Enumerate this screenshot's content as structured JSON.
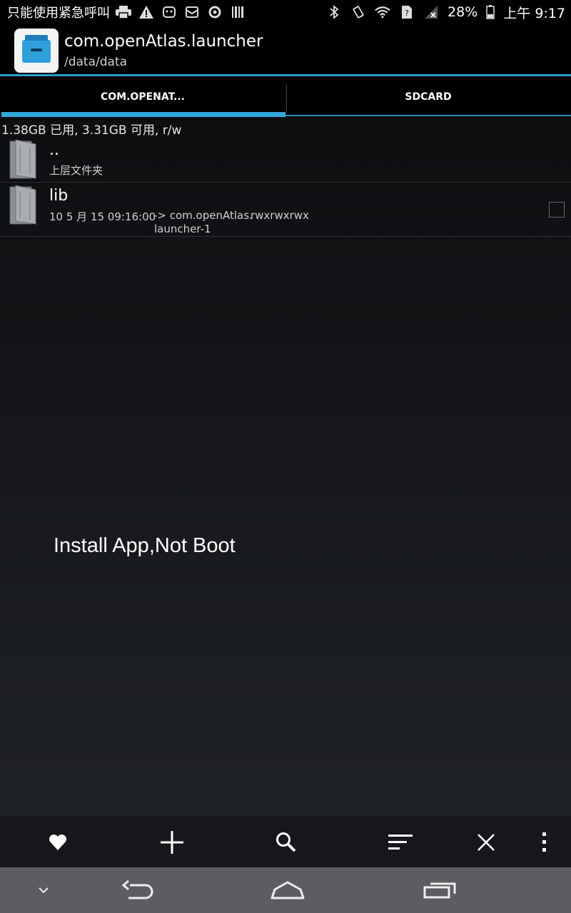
{
  "status_bar": {
    "carrier_text": "只能使用紧急呼叫",
    "battery_percent": "28%",
    "time": "上午 9:17",
    "icons_left": [
      "print-icon",
      "warning-icon",
      "android-icon",
      "mail-icon",
      "sync-icon",
      "barcode-icon"
    ],
    "icons_right": [
      "bluetooth-icon",
      "vibrate-icon",
      "wifi-icon",
      "no-sim-icon",
      "no-signal-icon",
      "battery-icon"
    ]
  },
  "action_bar": {
    "title": "com.openAtlas.launcher",
    "subtitle": "/data/data"
  },
  "tabs": [
    {
      "label": "COM.OPENAT...",
      "active": true
    },
    {
      "label": "SDCARD",
      "active": false
    }
  ],
  "storage_info": "1.38GB 已用, 3.31GB 可用, r/w",
  "files": [
    {
      "name": "..",
      "line1": "上层文件夹"
    },
    {
      "name": "lib",
      "date": "10 5 月 15 09:16:00",
      "link": "-> com.openAtlas.",
      "link2": "launcher-1",
      "perms": "rwxrwxrwx",
      "checked": false
    }
  ],
  "overlay_text": "Install App,Not Boot",
  "toolbar": [
    "favorite-icon",
    "add-icon",
    "search-icon",
    "sort-icon",
    "close-icon",
    "overflow-menu-icon"
  ],
  "navbar": [
    "hide-keyboard-icon",
    "back-icon",
    "home-icon",
    "recent-apps-icon"
  ],
  "colors": {
    "accent": "#33a7dd",
    "background": "#000000",
    "navbar": "#5b5d61"
  }
}
